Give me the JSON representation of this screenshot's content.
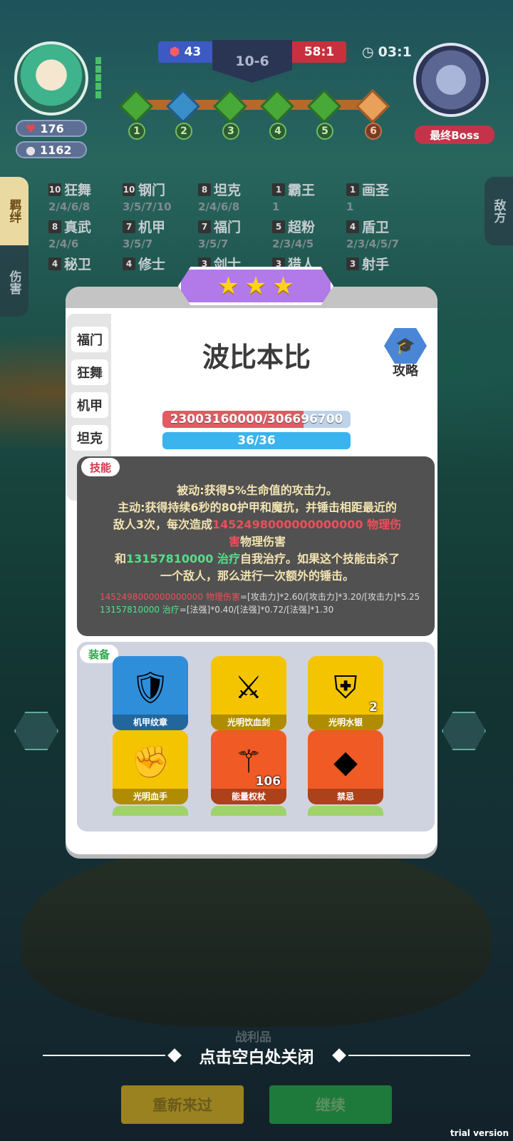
{
  "hud": {
    "player_hp": "176",
    "player_coins": "1162",
    "blue_score": "43",
    "stage": "10-6",
    "red_score": "58:1",
    "timer": "03:1",
    "boss_label": "最终Boss",
    "nodes": [
      "1",
      "2",
      "3",
      "4",
      "5",
      "6"
    ]
  },
  "side_tabs": {
    "left_active": "羁绊",
    "left_other": "伤害",
    "right": "敌方"
  },
  "bonds": [
    {
      "count": "10",
      "name": "狂舞",
      "tiers": "2/4/6/8"
    },
    {
      "count": "10",
      "name": "钢门",
      "tiers": "3/5/7/10"
    },
    {
      "count": "8",
      "name": "坦克",
      "tiers": "2/4/6/8"
    },
    {
      "count": "1",
      "name": "霸王",
      "tiers": "1"
    },
    {
      "count": "1",
      "name": "画圣",
      "tiers": "1"
    },
    {
      "count": "8",
      "name": "真武",
      "tiers": "2/4/6"
    },
    {
      "count": "7",
      "name": "机甲",
      "tiers": "3/5/7"
    },
    {
      "count": "7",
      "name": "福门",
      "tiers": "3/5/7"
    },
    {
      "count": "5",
      "name": "超粉",
      "tiers": "2/3/4/5"
    },
    {
      "count": "4",
      "name": "盾卫",
      "tiers": "2/3/4/5/7"
    },
    {
      "count": "4",
      "name": "秘卫",
      "tiers": ""
    },
    {
      "count": "4",
      "name": "修士",
      "tiers": ""
    },
    {
      "count": "3",
      "name": "剑士",
      "tiers": ""
    },
    {
      "count": "3",
      "name": "猎人",
      "tiers": ""
    },
    {
      "count": "3",
      "name": "射手",
      "tiers": ""
    }
  ],
  "dialog": {
    "hero_name": "波比本比",
    "guide_label": "攻略",
    "side_tags": [
      "福门",
      "狂舞",
      "机甲",
      "坦克"
    ],
    "hp_text": "23003160000/306696700",
    "hp_fraction": 0.75,
    "mp_text": "36/36",
    "skill_tag": "技能",
    "skill_line1": "被动:获得5%生命值的攻击力。",
    "skill_line2": "主动:获得持续6秒的80护甲和魔抗，并锤击相距最近的",
    "skill_line3a": "敌人3次，每次造成",
    "skill_dmg": "1452498000000000000 物理伤",
    "skill_line3b": "害",
    "skill_line3c": "物理伤害",
    "skill_heal_pre": "和",
    "skill_heal": "13157810000 治疗",
    "skill_line4": "自我治疗。如果这个技能击杀了",
    "skill_line5": "一个敌人，那么进行一次额外的锤击。",
    "formula1_val": "1452498000000000000 物理伤害",
    "formula1_expr": "=[攻击力]*2.60/[攻击力]*3.20/[攻击力]*5.25",
    "formula2_val": "13157810000 治疗",
    "formula2_expr": "=[法强]*0.40/[法强]*0.72/[法强]*1.30",
    "equip_tag": "装备",
    "items": [
      {
        "name": "机甲纹章",
        "count": ""
      },
      {
        "name": "光明饮血剑",
        "count": ""
      },
      {
        "name": "光明水银",
        "count": "2"
      },
      {
        "name": "光明血手",
        "count": ""
      },
      {
        "name": "能量权杖",
        "count": "106"
      },
      {
        "name": "禁忌",
        "count": ""
      }
    ]
  },
  "close_hint": "点击空白处关闭",
  "under_label": "战利品",
  "buttons": {
    "restart": "重新来过",
    "continue": "继续"
  },
  "watermark": "trial version"
}
